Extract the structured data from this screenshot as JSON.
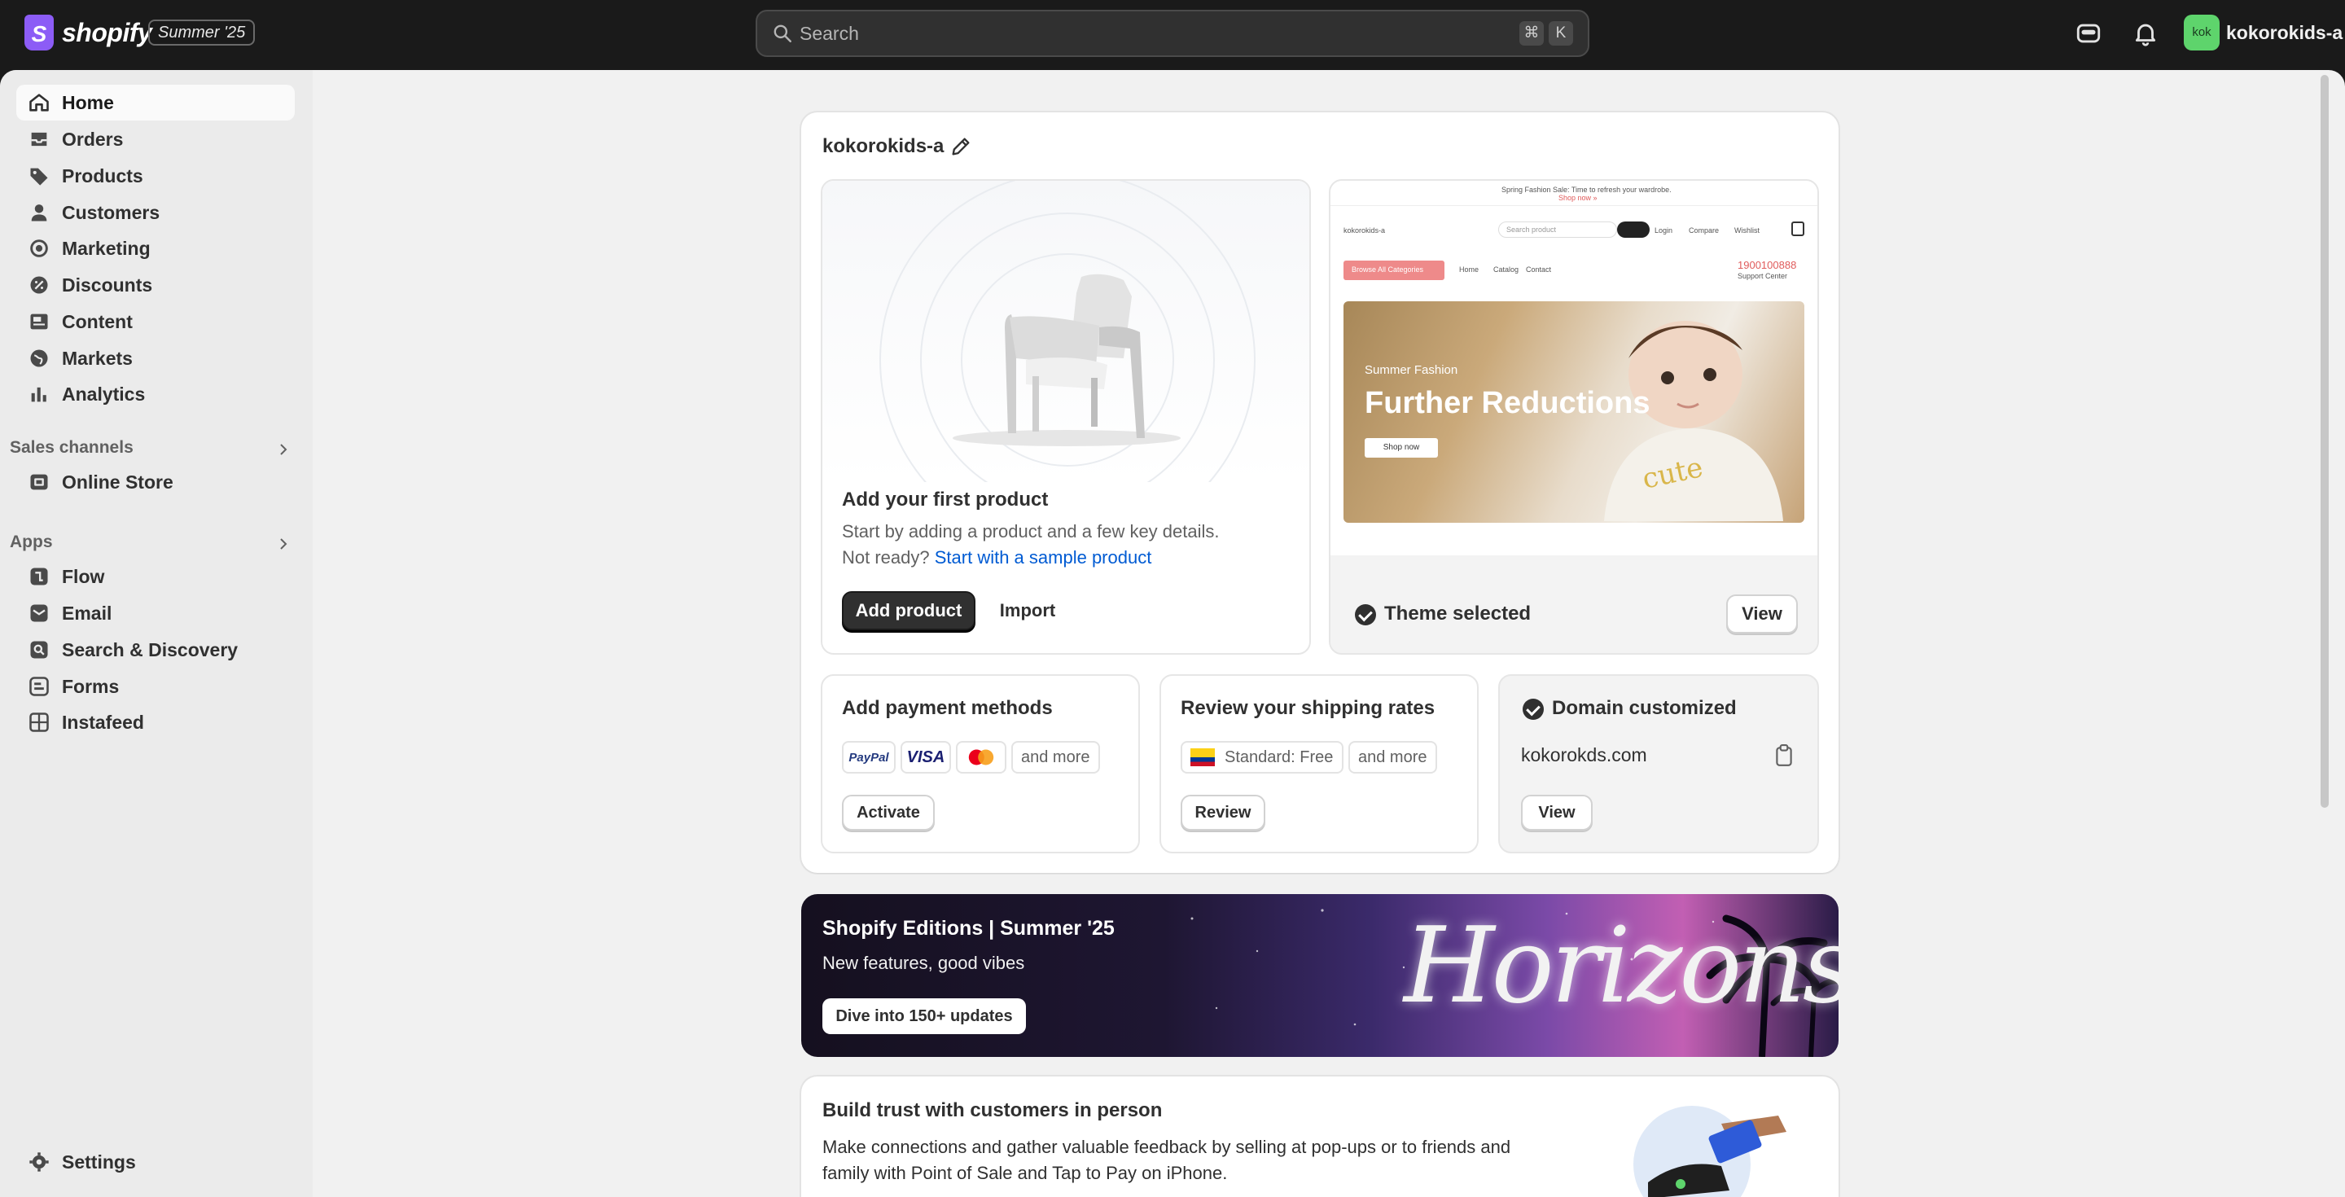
{
  "topbar": {
    "brand": "shopify",
    "brand_letter": "S",
    "edition_badge": "Summer '25",
    "search_placeholder": "Search",
    "shortcut_key1": "⌘",
    "shortcut_key2": "K",
    "avatar_initials": "kok",
    "store_name": "kokorokids-a"
  },
  "sidebar": {
    "items": [
      {
        "label": "Home",
        "icon": "home-icon"
      },
      {
        "label": "Orders",
        "icon": "inbox-icon"
      },
      {
        "label": "Products",
        "icon": "tag-icon"
      },
      {
        "label": "Customers",
        "icon": "person-icon"
      },
      {
        "label": "Marketing",
        "icon": "target-icon"
      },
      {
        "label": "Discounts",
        "icon": "discount-icon"
      },
      {
        "label": "Content",
        "icon": "content-icon"
      },
      {
        "label": "Markets",
        "icon": "globe-icon"
      },
      {
        "label": "Analytics",
        "icon": "bar-chart-icon"
      }
    ],
    "sales_channels_label": "Sales channels",
    "sales_channels": [
      {
        "label": "Online Store",
        "icon": "store-icon"
      }
    ],
    "apps_label": "Apps",
    "apps": [
      {
        "label": "Flow",
        "icon": "flow-icon"
      },
      {
        "label": "Email",
        "icon": "email-icon"
      },
      {
        "label": "Search & Discovery",
        "icon": "search-app-icon"
      },
      {
        "label": "Forms",
        "icon": "forms-icon"
      },
      {
        "label": "Instafeed",
        "icon": "grid-icon"
      }
    ],
    "settings_label": "Settings"
  },
  "setup": {
    "store_title": "kokorokids-a",
    "product": {
      "title": "Add your first product",
      "desc": "Start by adding a product and a few key details.",
      "not_ready": "Not ready?",
      "sample_link": "Start with a sample product",
      "primary_btn": "Add product",
      "secondary_btn": "Import"
    },
    "theme": {
      "announcement": "Spring Fashion Sale: Time to refresh your wardrobe.",
      "shop_now_small": "Shop now »",
      "store_logo_text": "kokorokids-a",
      "search_placeholder": "Search product",
      "login": "Login",
      "compare": "Compare",
      "wishlist": "Wishlist",
      "browse_categories": "Browse All Categories",
      "nav_home": "Home",
      "nav_catalog": "Catalog",
      "nav_contact": "Contact",
      "phone": "1900100888",
      "support": "Support Center",
      "hero_sub": "Summer Fashion",
      "hero_title": "Further Reductions",
      "hero_btn": "Shop now",
      "status": "Theme selected",
      "view_btn": "View"
    },
    "payments": {
      "title": "Add payment methods",
      "methods": [
        "PayPal",
        "VISA",
        "mastercard"
      ],
      "more": "and more",
      "btn": "Activate"
    },
    "shipping": {
      "title": "Review your shipping rates",
      "rate": "Standard: Free",
      "more": "and more",
      "btn": "Review"
    },
    "domain": {
      "title": "Domain customized",
      "domain": "kokorokds.com",
      "btn": "View"
    }
  },
  "banner": {
    "title": "Shopify Editions | Summer '25",
    "subtitle": "New features, good vibes",
    "btn": "Dive into 150+ updates",
    "art_text": "Horizons"
  },
  "pos_card": {
    "title": "Build trust with customers in person",
    "desc_line1": "Make connections and gather valuable feedback by selling at pop-ups or to friends and",
    "desc_line2": "family with Point of Sale and Tap to Pay on iPhone."
  }
}
